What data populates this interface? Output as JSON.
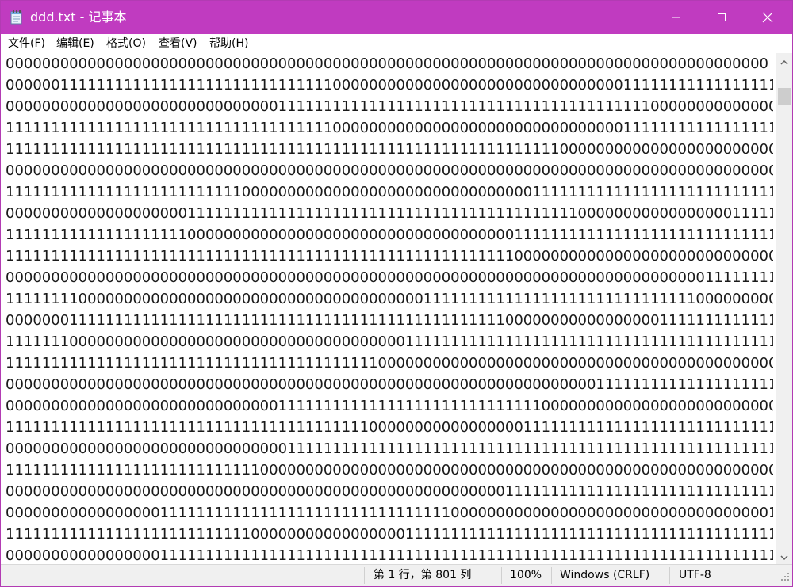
{
  "window": {
    "title": "ddd.txt - 记事本",
    "icon": "notepad-icon",
    "accent_color": "#c03bc0",
    "controls": [
      "minimize-icon",
      "maximize-icon",
      "close-icon"
    ]
  },
  "menu": {
    "items": [
      {
        "label": "文件(F)"
      },
      {
        "label": "编辑(E)"
      },
      {
        "label": "格式(O)"
      },
      {
        "label": "查看(V)"
      },
      {
        "label": "帮助(H)"
      }
    ]
  },
  "editor": {
    "lines": [
      "000000000000000000000000000000000000000000000000000000000000000000000000000000000000",
      "000000111111111111111111111111111111000000000000000000000000000000001111111111111111111111111111100",
      "0000000000000000000000000000001111111111111111111111111111111111111111100000000000000000111111",
      "1111111111111111111111111111111111110000000000000000000000000000000011111111111111111111111111111",
      "1111111111111111111111111111111111111111111111111111111111111000000000000000000000000000000000",
      "0000000000000000000000000000000000000000000000000000000000000000000000000000000000000001111111",
      "1111111111111111111111111100000000000000000000000000000000111111111111111111111111111110000000000000",
      "0000000000000000000011111111111111111111111111111111111111111110000000000000000011111111111111111111",
      "1111111111111111111100000000000000000000000000000000000011111111111111111111111111111111111111111111",
      "11111111111111111111111111111111111111111111111111111111000000000000000000000000000000000000000000",
      "0000000000000000000000000000000000000000000000000000000000000000000000000000011111111111111111111",
      "11111111000000000000000000000000000000000000001111111111111111111111111111110000000000000000000000000",
      "0000000111111111111111111111111111111111111111111111111000000000000000001111111111111111111111111111",
      "11111110000000000000000000000000000000000000111111111111111111111111111111111111111111111111111111111",
      "1111111111111111111111111111111111111111100000000000000000000000000000000000000000000000000000000000",
      "0000000000000000000000000000000000000000000000000000000000000000011111111111111111111111111111100000",
      "0000000000000000000000000000001111111111111111111111111111100000000000000000000000000000000000111111",
      "111111111111111111111111111111111111111100000000000000000111111111111111111111111111111111111000000",
      "0000000000000000000000000000000111111111111111111111111111111111111111111111111111111111111111111111",
      "111111111111111111111111111100000000000000000000000000000000000000000000000000000000000000000000000",
      "0000000000000000000000000000000000000000000000000000000111111111111111111111111111111000000000000000",
      "0000000000000000011111111111111111111111111111111000000000000000000000000000000000001111111111111111",
      "1111111111111111111111111110000000000000000011111111111111111111111111111111111111111111100000000000000",
      "0000000000000000011111111111111111111111111111111111111111111111111111111111111111111111111111111111"
    ]
  },
  "status": {
    "position": "第 1 行，第 801 列",
    "zoom": "100%",
    "line_ending": "Windows (CRLF)",
    "encoding": "UTF-8"
  }
}
